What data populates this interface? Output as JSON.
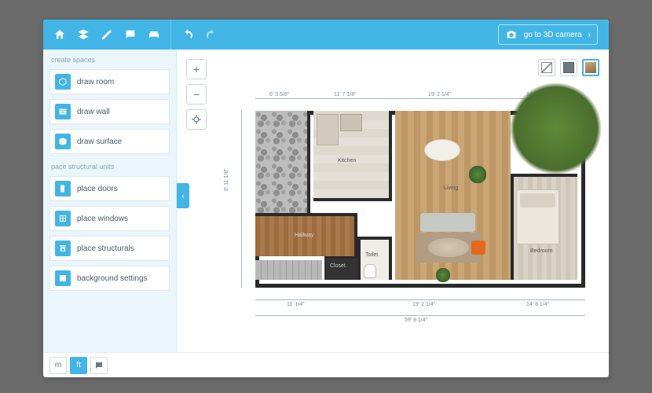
{
  "topbar": {
    "go3d_label": "go to 3D camera"
  },
  "sidebar": {
    "section_spaces": "create spaces",
    "section_structural": "pace structural units",
    "tools": {
      "draw_room": "draw room",
      "draw_wall": "draw wall",
      "draw_surface": "draw surface",
      "place_doors": "place doors",
      "place_windows": "place windows",
      "place_structurals": "place structurals",
      "background_settings": "background settings"
    }
  },
  "rooms": {
    "kitchen": "Kitchen",
    "hallway": "Hallway",
    "closet": "Closet",
    "toilet": "Toilet",
    "living": "Living",
    "bedroom": "Bedroom"
  },
  "dimensions": {
    "top1": "6' 3 5/8\"",
    "top2": "11' 7 1/8\"",
    "top3": "19' 2 1/4\"",
    "top4": "14' 8 1/4\"",
    "left_total": "8' 11 1/8\"",
    "bottom1": "11' 1/4\"",
    "bottom2": "19' 2 1/4\"",
    "bottom3": "14' 8 1/4\"",
    "bottom_total": "59' 8 1/4\""
  },
  "units": {
    "m": "m",
    "ft": "ft"
  },
  "colors": {
    "accent": "#41b6e6",
    "panel": "#eaf6fc"
  }
}
